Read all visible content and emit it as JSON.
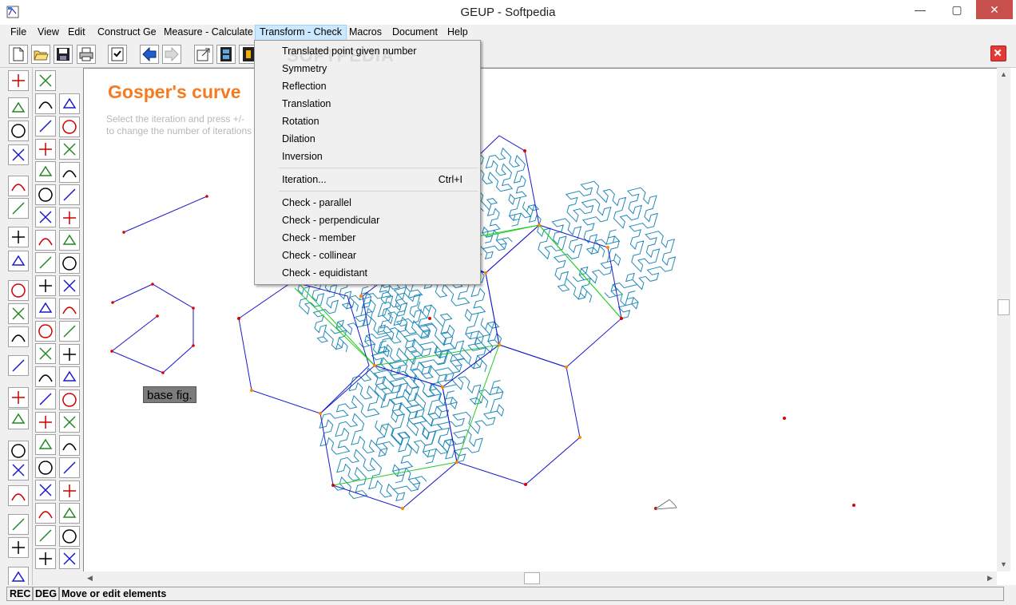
{
  "window": {
    "title": "GEUP - Softpedia",
    "minimize": "—",
    "maximize": "▢",
    "close": "✕"
  },
  "menubar": [
    "File",
    "View",
    "Edit",
    "Construct Ge",
    "Measure - Calculate",
    "Transform - Check",
    "Macros",
    "Document",
    "Help"
  ],
  "dropdown": {
    "items": [
      "Translated point given number",
      "Symmetry",
      "Reflection",
      "Translation",
      "Rotation",
      "Dilation",
      "Inversion"
    ],
    "iteration": {
      "label": "Iteration...",
      "shortcut": "Ctrl+I"
    },
    "checks": [
      "Check - parallel",
      "Check - perpendicular",
      "Check - member",
      "Check - collinear",
      "Check - equidistant"
    ],
    "watermark": "SOFTPEDIA"
  },
  "document": {
    "title": "Gosper's curve",
    "hint_line1": "Select the iteration and press +/-",
    "hint_line2": "to change the number of iterations",
    "base_label": "base fig."
  },
  "status": {
    "rec": "REC",
    "deg": "DEG",
    "message": "Move or edit elements"
  },
  "colors": {
    "title": "#f47b20",
    "curve": "#1f8ab8",
    "hexagon": "#1a1acc",
    "green": "#22cc22",
    "point_red": "#e00000",
    "point_orange": "#ff8800"
  },
  "icons": {
    "app": "app-icon",
    "new": "new-file-icon",
    "open": "open-folder-icon",
    "save": "save-icon",
    "print": "print-icon",
    "check": "checklist-icon",
    "back": "back-arrow-icon",
    "forward": "forward-arrow-icon",
    "close_doc": "close-doc-icon"
  }
}
